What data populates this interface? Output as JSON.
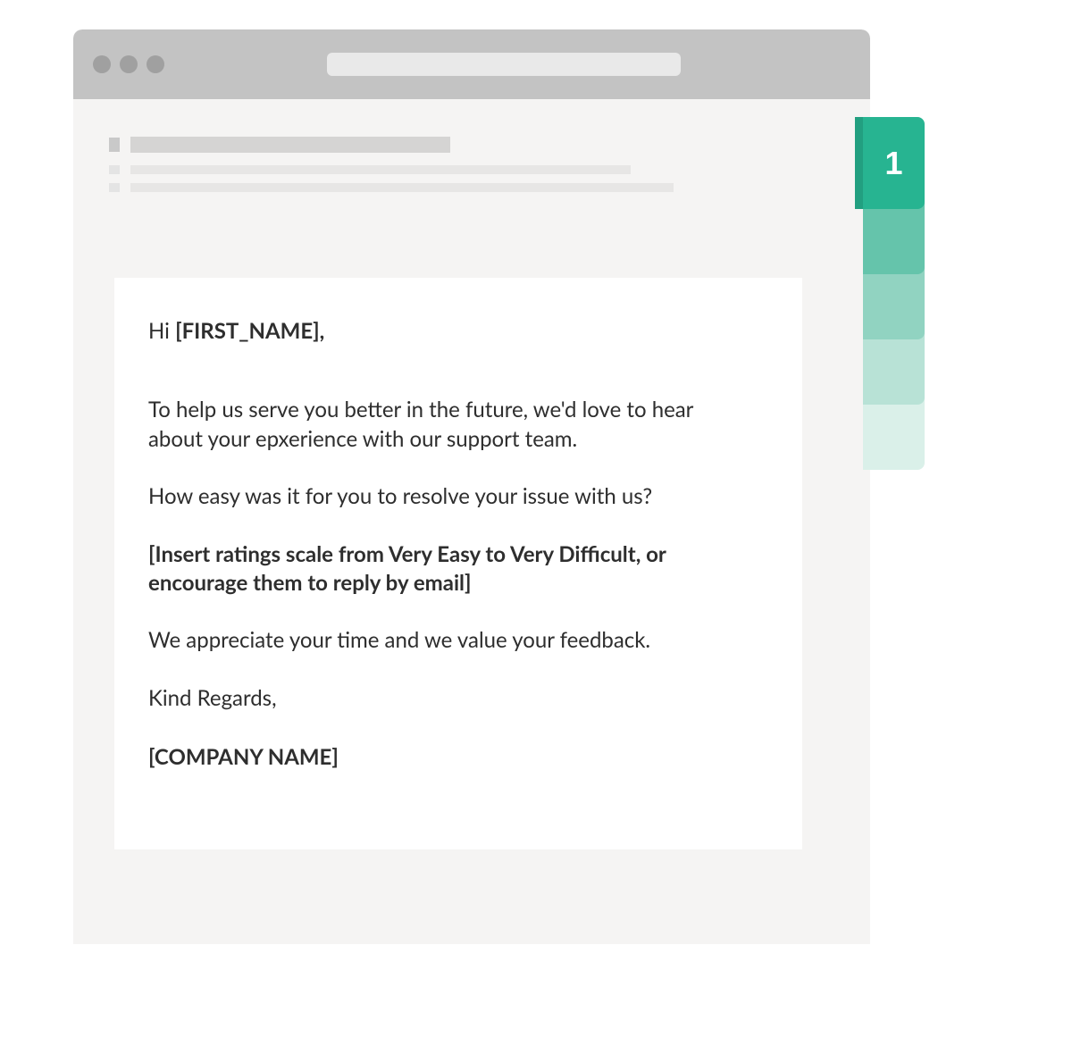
{
  "tabs": {
    "active_index": 0,
    "items": [
      {
        "label": "1",
        "color": "#27b491"
      },
      {
        "label": "",
        "color": "#65c4ab"
      },
      {
        "label": "",
        "color": "#91d3c1"
      },
      {
        "label": "",
        "color": "#b8e2d6"
      },
      {
        "label": "",
        "color": "#daf0e9"
      }
    ]
  },
  "email": {
    "greeting_prefix": "Hi ",
    "greeting_token": "[FIRST_NAME],",
    "paragraphs": {
      "intro": "To help us serve you better in the future, we'd love to hear about your epxerience with our support team.",
      "question": "How easy was it for you to resolve your issue with us?",
      "placeholder_bold": "[Insert ratings scale from Very Easy to Very Difficult, or encourage them to reply by email]",
      "appreciation": "We appreciate your time and we value your feedback.",
      "signoff": "Kind Regards,",
      "sender": "[COMPANY NAME]"
    }
  }
}
